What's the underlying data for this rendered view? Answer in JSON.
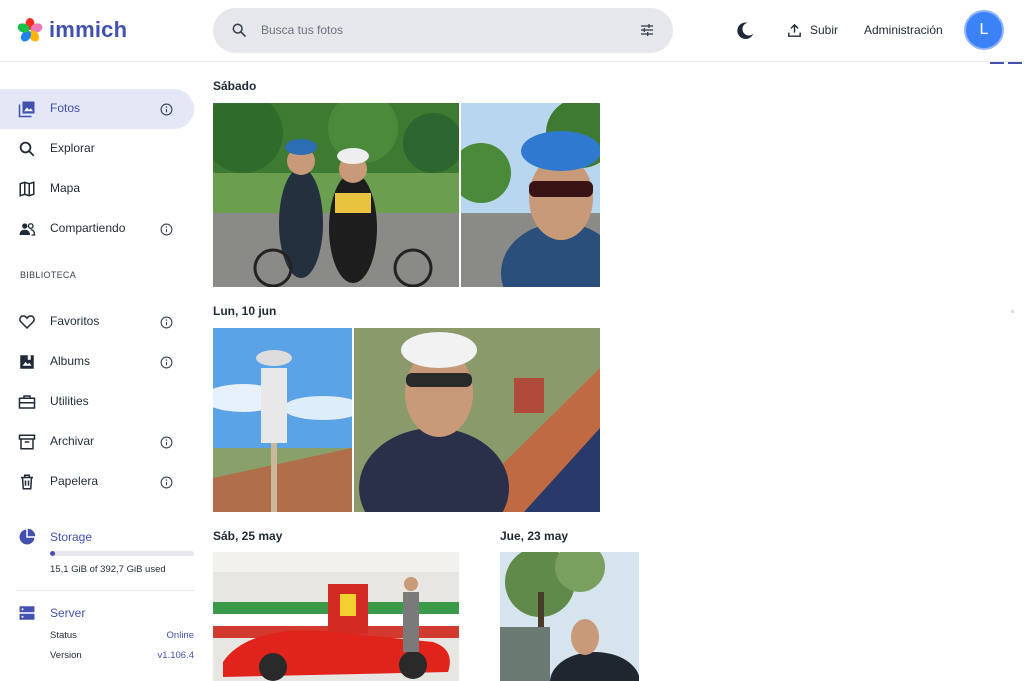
{
  "app": {
    "name": "immich",
    "brand_color": "#4250af"
  },
  "header": {
    "search_placeholder": "Busca tus fotos",
    "upload_label": "Subir",
    "admin_label": "Administración",
    "avatar_initial": "L"
  },
  "sidebar": {
    "items": [
      {
        "label": "Fotos",
        "icon": "photos-icon",
        "info": true,
        "active": true
      },
      {
        "label": "Explorar",
        "icon": "search-icon",
        "info": false
      },
      {
        "label": "Mapa",
        "icon": "map-icon",
        "info": false
      },
      {
        "label": "Compartiendo",
        "icon": "people-icon",
        "info": true
      }
    ],
    "library_title": "BIBLIOTECA",
    "library_items": [
      {
        "label": "Favoritos",
        "icon": "heart-icon",
        "info": true
      },
      {
        "label": "Albums",
        "icon": "album-icon",
        "info": true
      },
      {
        "label": "Utilities",
        "icon": "toolbox-icon",
        "info": false
      },
      {
        "label": "Archivar",
        "icon": "archive-icon",
        "info": true
      },
      {
        "label": "Papelera",
        "icon": "trash-icon",
        "info": true
      }
    ],
    "storage": {
      "title": "Storage",
      "used_text": "15,1 GiB of 392,7 GiB used",
      "used_fraction": 0.038
    },
    "server": {
      "title": "Server",
      "status_label": "Status",
      "status_value": "Online",
      "version_label": "Version",
      "version_value": "v1.106.4"
    }
  },
  "timeline": {
    "groups": [
      {
        "date": "Sábado"
      },
      {
        "date": "Lun, 10 jun"
      },
      {
        "date": "Sáb, 25 may"
      },
      {
        "date": "Jue, 23 may"
      }
    ]
  }
}
